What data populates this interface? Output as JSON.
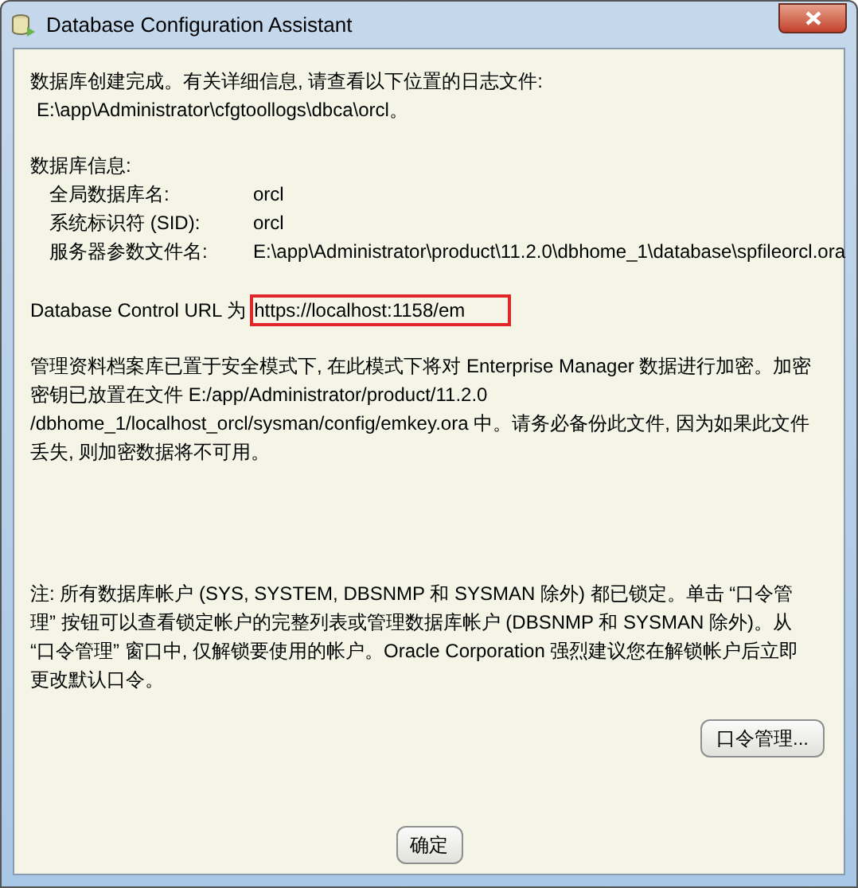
{
  "window": {
    "title": "Database Configuration Assistant"
  },
  "intro": {
    "text": "数据库创建完成。有关详细信息, 请查看以下位置的日志文件:",
    "path": "E:\\app\\Administrator\\cfgtoollogs\\dbca\\orcl。"
  },
  "database_info": {
    "heading": "数据库信息:",
    "rows": [
      {
        "label": "全局数据库名:",
        "value": "orcl"
      },
      {
        "label": "系统标识符 (SID):",
        "value": "orcl"
      },
      {
        "label": "服务器参数文件名:",
        "value": "E:\\app\\Administrator\\product\\11.2.0\\dbhome_1\\database\\spfileorcl.ora"
      }
    ]
  },
  "control_url": {
    "label": "Database Control URL 为",
    "url": "https://localhost:1158/em",
    "highlighted": true
  },
  "encryption_note": "管理资料档案库已置于安全模式下, 在此模式下将对 Enterprise Manager 数据进行加密。加密密钥已放置在文件 E:/app/Administrator/product/11.2.0 /dbhome_1/localhost_orcl/sysman/config/emkey.ora 中。请务必备份此文件, 因为如果此文件丢失, 则加密数据将不可用。",
  "account_note": "注: 所有数据库帐户 (SYS, SYSTEM, DBSNMP 和 SYSMAN 除外) 都已锁定。单击 “口令管理” 按钮可以查看锁定帐户的完整列表或管理数据库帐户 (DBSNMP 和 SYSMAN 除外)。从 “口令管理” 窗口中, 仅解锁要使用的帐户。Oracle Corporation 强烈建议您在解锁帐户后立即更改默认口令。",
  "buttons": [
    {
      "label": "口令管理...",
      "kind": "side"
    },
    {
      "label": "确定",
      "kind": "main"
    }
  ]
}
